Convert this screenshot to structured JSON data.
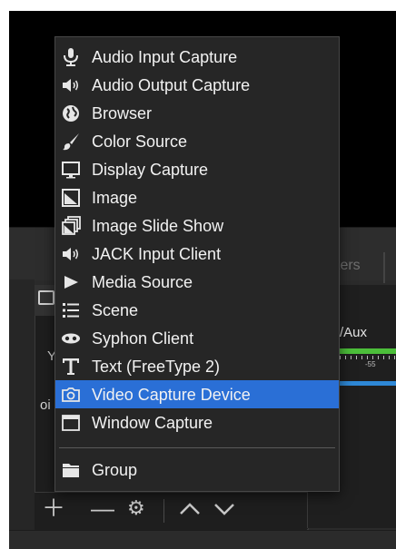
{
  "background_panels": {
    "filters_tab": "ters",
    "sources_fragment_1": "Y",
    "sources_fragment_2": "oi",
    "audio_channel": "/Aux",
    "meter_scale": "-55"
  },
  "toolbar": {
    "add_icon": "plus-icon",
    "remove_icon": "minus-icon",
    "settings_icon": "gear-icon",
    "up_icon": "chevron-up-icon",
    "down_icon": "chevron-down-icon"
  },
  "menu": {
    "items": [
      {
        "label": "Audio Input Capture",
        "icon": "microphone-icon"
      },
      {
        "label": "Audio Output Capture",
        "icon": "speaker-icon"
      },
      {
        "label": "Browser",
        "icon": "globe-icon"
      },
      {
        "label": "Color Source",
        "icon": "brush-icon"
      },
      {
        "label": "Display Capture",
        "icon": "monitor-icon"
      },
      {
        "label": "Image",
        "icon": "image-icon"
      },
      {
        "label": "Image Slide Show",
        "icon": "slideshow-icon"
      },
      {
        "label": "JACK Input Client",
        "icon": "speaker-icon"
      },
      {
        "label": "Media Source",
        "icon": "play-icon"
      },
      {
        "label": "Scene",
        "icon": "list-icon"
      },
      {
        "label": "Syphon Client",
        "icon": "syphon-icon"
      },
      {
        "label": "Text (FreeType 2)",
        "icon": "text-icon"
      },
      {
        "label": "Video Capture Device",
        "icon": "camera-icon"
      },
      {
        "label": "Window Capture",
        "icon": "window-icon"
      },
      {
        "label": "Group",
        "icon": "folder-icon"
      }
    ],
    "selected": "Video Capture Device"
  },
  "colors": {
    "selection": "#2a6fd6",
    "meter_green": "#4cbf3a",
    "meter_blue": "#2e88d6"
  }
}
